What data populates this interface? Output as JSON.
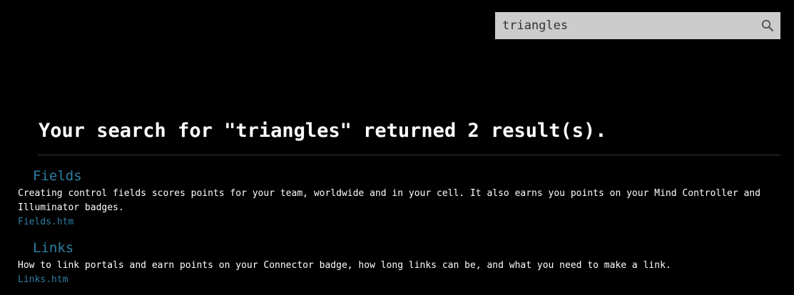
{
  "search": {
    "value": "triangles",
    "icon": "search-icon"
  },
  "heading": "Your search for \"triangles\" returned 2 result(s).",
  "results": [
    {
      "title": "Fields",
      "description": "Creating control fields scores points for your team, worldwide and in your cell. It also earns you points on your Mind Controller and Illuminator badges.",
      "link": "Fields.htm"
    },
    {
      "title": "Links",
      "description": "How to link portals and earn points on your Connector badge, how long links can be, and what you need to make a link.",
      "link": "Links.htm"
    }
  ],
  "colors": {
    "background": "#000000",
    "link": "#2e7fa5",
    "search_box": "#cccccc"
  }
}
